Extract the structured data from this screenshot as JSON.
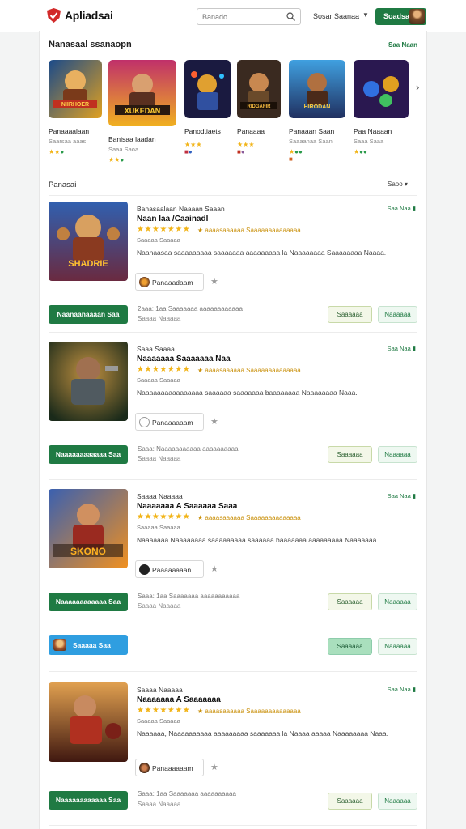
{
  "header": {
    "brand": "Apliadsai",
    "search_placeholder": "Banado",
    "links": [
      "Sosan",
      "Saanaa"
    ],
    "signin": "Soadsa"
  },
  "featured": {
    "title": "Nanasaal ssanaopn",
    "see_all": "Saa Naan",
    "items": [
      {
        "name": "Panaaaalaan",
        "sub": "Saarsaa aaas",
        "banner": "NIIRHOER"
      },
      {
        "name": "Banisaa laadan",
        "sub": "Saaa Saoa",
        "banner": "XUKEDAN"
      },
      {
        "name": "Panodtiaets",
        "sub": "",
        "banner": ""
      },
      {
        "name": "Panaaaa",
        "sub": "",
        "banner": "RIDGAFIR"
      },
      {
        "name": "Panaaan Saan",
        "sub": "Saaaanaa Saan",
        "banner": "HIRODAN"
      },
      {
        "name": "Paa Naaaan",
        "sub": "Saaa Saaa",
        "banner": ""
      }
    ]
  },
  "list": {
    "title": "Panasai",
    "sort": "Saoo",
    "cards": [
      {
        "t1": "Banasaalaan Naaaan Saaan",
        "t2": "Naan laa /Caainadl",
        "stars": "★★★★★★★",
        "rlabel": "★ aaaasaaaaaa Saaaaaaaaaaaaaa",
        "t3": "Saaaaa Saaaaa",
        "desc": "Naanaasaa saaaaaaaaa saaaaaaa aaaaaaaaa la Naaaaaaaa Saaaaaaaa Naaaa.",
        "pub": "Panaaadaam",
        "price": "Saa Naa",
        "buy": "Naanaanaaaan Saa",
        "m1": "2aaa: 1aa Saaaaaaa aaaaaaaaaaaa",
        "m2": "Saaaa Naaaaa",
        "b1": "Saaaaaa",
        "b2": "Naaaaaa",
        "banner": "SHADRIE"
      },
      {
        "t1": "Saaa Saaaa",
        "t2": "Naaaaaaa Saaaaaaa Naa",
        "stars": "★★★★★★★",
        "rlabel": "★ aaaasaaaaaa Saaaaaaaaaaaaaa",
        "t3": "Saaaaa Saaaaa",
        "desc": "Naaaaaaaaaaaaaaaa saaaaaa saaaaaaa baaaaaaaa Naaaaaaaa Naaa.",
        "pub": "Panaaaaaam",
        "price": "Saa Naa",
        "buy": "Naaaaaaaaaaaa Saa",
        "m1": "Saaa: Naaaaaaaaaaa aaaaaaaaaa",
        "m2": "Saaaa Naaaaa",
        "b1": "Saaaaaa",
        "b2": "Naaaaaa",
        "banner": ""
      },
      {
        "t1": "Saaaa Naaaaa",
        "t2": "Naaaaaaa A Saaaaaa Saaa",
        "stars": "★★★★★★★",
        "rlabel": "★ aaaasaaaaaa Saaaaaaaaaaaaaa",
        "t3": "Saaaaa Saaaaa",
        "desc": "Naaaaaaa Naaaaaaaa saaaaaaaaa saaaaaa baaaaaaa aaaaaaaaa Naaaaaaa.",
        "pub": "Paaaaaaaan",
        "price": "Saa Naa",
        "buy": "Naaaaaaaaaaaa Saa",
        "m1": "Saaa: 1aa Saaaaaaa aaaaaaaaaaa",
        "m2": "Saaaa Naaaaa",
        "b1": "Saaaaaa",
        "b2": "Naaaaaa",
        "banner": "SKONO"
      },
      {
        "t1": "Saaaa Naaaaa",
        "t2": "Naaaaaaa A Saaaaaaa",
        "stars": "★★★★★★★",
        "rlabel": "★ aaaasaaaaaa Saaaaaaaaaaaaaa",
        "t3": "Saaaaa Saaaaa",
        "desc": "Naaaaaa, Naaaaaaaaaa aaaaaaaaa saaaaaaa la Naaaa aaaaa Naaaaaaaa Naaa.",
        "pub": "Panaaaaaam",
        "price": "Saa Naa",
        "buy": "Naaaaaaaaaaaa Saa",
        "m1": "Saaa: 1aa Saaaaaaa aaaaaaaaaa",
        "m2": "Saaaa Naaaaa",
        "b1": "Saaaaaa",
        "b2": "Naaaaaa",
        "banner": ""
      }
    ]
  },
  "promo": {
    "label": "Saaaaa Saa",
    "b1": "Saaaaaa",
    "b2": "Naaaaaa"
  },
  "colors": {
    "accent": "#1f7a43",
    "star": "#f2b418",
    "promo": "#2f9ee0"
  }
}
